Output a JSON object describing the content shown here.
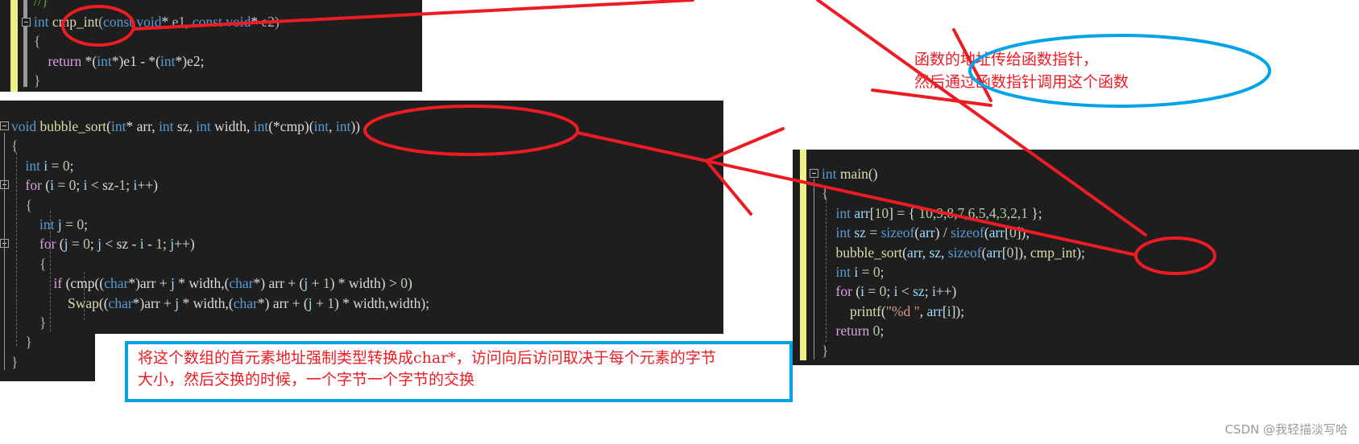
{
  "snippet_cmp": {
    "comment": "//}",
    "lines": [
      [
        {
          "t": "int",
          "c": "kw"
        },
        {
          "t": " "
        },
        {
          "t": "cmp_int",
          "c": "fn"
        },
        {
          "t": "(",
          "c": "punc"
        },
        {
          "t": "const",
          "c": "kw"
        },
        {
          "t": " "
        },
        {
          "t": "void",
          "c": "kw"
        },
        {
          "t": "* "
        },
        {
          "t": "e1",
          "c": "punc"
        },
        {
          "t": ", "
        },
        {
          "t": "const",
          "c": "kw"
        },
        {
          "t": " "
        },
        {
          "t": "void",
          "c": "kw"
        },
        {
          "t": "* "
        },
        {
          "t": "e2",
          "c": "punc"
        },
        {
          "t": ")",
          "c": "punc"
        }
      ],
      [
        {
          "t": "{",
          "c": "punc"
        }
      ],
      [
        {
          "t": "    "
        },
        {
          "t": "return",
          "c": "ctl"
        },
        {
          "t": " *("
        },
        {
          "t": "int",
          "c": "kw"
        },
        {
          "t": "*)e1 - *("
        },
        {
          "t": "int",
          "c": "kw"
        },
        {
          "t": "*)e2;"
        }
      ],
      [
        {
          "t": "}",
          "c": "punc"
        }
      ]
    ]
  },
  "snippet_bubble": {
    "lines": [
      [
        {
          "t": "void",
          "c": "kw"
        },
        {
          "t": " "
        },
        {
          "t": "bubble_sort",
          "c": "fn"
        },
        {
          "t": "("
        },
        {
          "t": "int",
          "c": "kw"
        },
        {
          "t": "* arr, "
        },
        {
          "t": "int",
          "c": "kw"
        },
        {
          "t": " sz, "
        },
        {
          "t": "int",
          "c": "kw"
        },
        {
          "t": " width, "
        },
        {
          "t": "int",
          "c": "kw"
        },
        {
          "t": "(*cmp)("
        },
        {
          "t": "int",
          "c": "kw"
        },
        {
          "t": ", "
        },
        {
          "t": "int",
          "c": "kw"
        },
        {
          "t": "))"
        }
      ],
      [
        {
          "t": "{",
          "c": "punc"
        }
      ],
      [
        {
          "t": "    "
        },
        {
          "t": "int",
          "c": "kw"
        },
        {
          "t": " "
        },
        {
          "t": "i",
          "c": "var"
        },
        {
          "t": " = "
        },
        {
          "t": "0",
          "c": "num"
        },
        {
          "t": ";"
        }
      ],
      [
        {
          "t": "    "
        },
        {
          "t": "for",
          "c": "ctl"
        },
        {
          "t": " ("
        },
        {
          "t": "i",
          "c": "var"
        },
        {
          "t": " = "
        },
        {
          "t": "0",
          "c": "num"
        },
        {
          "t": "; "
        },
        {
          "t": "i",
          "c": "var"
        },
        {
          "t": " < sz-"
        },
        {
          "t": "1",
          "c": "num"
        },
        {
          "t": "; "
        },
        {
          "t": "i",
          "c": "var"
        },
        {
          "t": "++)"
        }
      ],
      [
        {
          "t": "    "
        },
        {
          "t": "{",
          "c": "punc"
        }
      ],
      [
        {
          "t": "        "
        },
        {
          "t": "int",
          "c": "kw"
        },
        {
          "t": " "
        },
        {
          "t": "j",
          "c": "var"
        },
        {
          "t": " = "
        },
        {
          "t": "0",
          "c": "num"
        },
        {
          "t": ";"
        }
      ],
      [
        {
          "t": "        "
        },
        {
          "t": "for",
          "c": "ctl"
        },
        {
          "t": " ("
        },
        {
          "t": "j",
          "c": "var"
        },
        {
          "t": " = "
        },
        {
          "t": "0",
          "c": "num"
        },
        {
          "t": "; "
        },
        {
          "t": "j",
          "c": "var"
        },
        {
          "t": " < sz - "
        },
        {
          "t": "i",
          "c": "var"
        },
        {
          "t": " - "
        },
        {
          "t": "1",
          "c": "num"
        },
        {
          "t": "; "
        },
        {
          "t": "j",
          "c": "var"
        },
        {
          "t": "++)"
        }
      ],
      [
        {
          "t": "        "
        },
        {
          "t": "{",
          "c": "punc"
        }
      ],
      [
        {
          "t": "            "
        },
        {
          "t": "if",
          "c": "ctl"
        },
        {
          "t": " (cmp(("
        },
        {
          "t": "char",
          "c": "kw"
        },
        {
          "t": "*)arr + "
        },
        {
          "t": "j",
          "c": "var"
        },
        {
          "t": " * width,("
        },
        {
          "t": "char",
          "c": "kw"
        },
        {
          "t": "*) arr + ("
        },
        {
          "t": "j",
          "c": "var"
        },
        {
          "t": " + "
        },
        {
          "t": "1",
          "c": "num"
        },
        {
          "t": ") * width) > "
        },
        {
          "t": "0",
          "c": "num"
        },
        {
          "t": ")"
        }
      ],
      [
        {
          "t": "                "
        },
        {
          "t": "Swap",
          "c": "fn"
        },
        {
          "t": "(("
        },
        {
          "t": "char",
          "c": "kw"
        },
        {
          "t": "*)arr + "
        },
        {
          "t": "j",
          "c": "var"
        },
        {
          "t": " * width,("
        },
        {
          "t": "char",
          "c": "kw"
        },
        {
          "t": "*) arr + ("
        },
        {
          "t": "j",
          "c": "var"
        },
        {
          "t": " + "
        },
        {
          "t": "1",
          "c": "num"
        },
        {
          "t": ") * width,width);"
        }
      ],
      [
        {
          "t": "        "
        },
        {
          "t": "}",
          "c": "punc"
        }
      ],
      [
        {
          "t": "    "
        },
        {
          "t": "}",
          "c": "punc"
        }
      ],
      [
        {
          "t": "}",
          "c": "punc"
        }
      ]
    ]
  },
  "snippet_main": {
    "lines": [
      [
        {
          "t": "int",
          "c": "kw"
        },
        {
          "t": " "
        },
        {
          "t": "main",
          "c": "fn"
        },
        {
          "t": "()"
        }
      ],
      [
        {
          "t": "{",
          "c": "punc"
        }
      ],
      [
        {
          "t": "    "
        },
        {
          "t": "int",
          "c": "kw"
        },
        {
          "t": " "
        },
        {
          "t": "arr",
          "c": "var"
        },
        {
          "t": "["
        },
        {
          "t": "10",
          "c": "num"
        },
        {
          "t": "] = { "
        },
        {
          "t": "10,9,8,7,6,5,4,3,2,1",
          "c": "num"
        },
        {
          "t": " };"
        }
      ],
      [
        {
          "t": "    "
        },
        {
          "t": "int",
          "c": "kw"
        },
        {
          "t": " "
        },
        {
          "t": "sz",
          "c": "var"
        },
        {
          "t": " = "
        },
        {
          "t": "sizeof",
          "c": "kw"
        },
        {
          "t": "("
        },
        {
          "t": "arr",
          "c": "var"
        },
        {
          "t": ") / "
        },
        {
          "t": "sizeof",
          "c": "kw"
        },
        {
          "t": "("
        },
        {
          "t": "arr",
          "c": "var"
        },
        {
          "t": "["
        },
        {
          "t": "0",
          "c": "num"
        },
        {
          "t": "]);"
        }
      ],
      [
        {
          "t": "    "
        },
        {
          "t": "bubble_sort",
          "c": "fn"
        },
        {
          "t": "("
        },
        {
          "t": "arr",
          "c": "var"
        },
        {
          "t": ", "
        },
        {
          "t": "sz",
          "c": "var"
        },
        {
          "t": ", "
        },
        {
          "t": "sizeof",
          "c": "kw"
        },
        {
          "t": "("
        },
        {
          "t": "arr",
          "c": "var"
        },
        {
          "t": "["
        },
        {
          "t": "0",
          "c": "num"
        },
        {
          "t": "]), "
        },
        {
          "t": "cmp_int",
          "c": "fn"
        },
        {
          "t": ");"
        }
      ],
      [
        {
          "t": "    "
        },
        {
          "t": "int",
          "c": "kw"
        },
        {
          "t": " "
        },
        {
          "t": "i",
          "c": "var"
        },
        {
          "t": " = "
        },
        {
          "t": "0",
          "c": "num"
        },
        {
          "t": ";"
        }
      ],
      [
        {
          "t": "    "
        },
        {
          "t": "for",
          "c": "ctl"
        },
        {
          "t": " ("
        },
        {
          "t": "i",
          "c": "var"
        },
        {
          "t": " = "
        },
        {
          "t": "0",
          "c": "num"
        },
        {
          "t": "; "
        },
        {
          "t": "i",
          "c": "var"
        },
        {
          "t": " < "
        },
        {
          "t": "sz",
          "c": "var"
        },
        {
          "t": "; "
        },
        {
          "t": "i",
          "c": "var"
        },
        {
          "t": "++)"
        }
      ],
      [
        {
          "t": "        "
        },
        {
          "t": "printf",
          "c": "fn"
        },
        {
          "t": "("
        },
        {
          "t": "\"%d \"",
          "c": "str"
        },
        {
          "t": ", "
        },
        {
          "t": "arr",
          "c": "var"
        },
        {
          "t": "["
        },
        {
          "t": "i",
          "c": "var"
        },
        {
          "t": "]);"
        }
      ],
      [
        {
          "t": "    "
        },
        {
          "t": "return",
          "c": "ctl"
        },
        {
          "t": " "
        },
        {
          "t": "0",
          "c": "num"
        },
        {
          "t": ";"
        }
      ],
      [
        {
          "t": "}",
          "c": "punc"
        }
      ]
    ]
  },
  "notes": {
    "function_pointer_line1": "函数的地址传给函数指针，",
    "function_pointer_line2": "然后通过函数指针调用这个函数",
    "char_cast_line1": "将这个数组的首元素地址强制类型转换成char*，访问向后访问取决于每个元素的字节",
    "char_cast_line2": "大小，然后交换的时候，一个字节一个字节的交换"
  },
  "watermark": "CSDN @我轻描淡写哈",
  "colors": {
    "annotation_red": "#ed1c24",
    "annotation_blue": "#00a2e8",
    "editor_bg": "#1e1e1e"
  }
}
